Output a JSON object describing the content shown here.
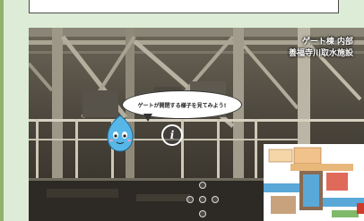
{
  "header": {
    "box_label": ""
  },
  "viewer": {
    "caption_line1": "ゲート棟 内部",
    "caption_line2": "善福寺川取水施設",
    "speech": "ゲートが開閉する様子を見てみよう!",
    "info_symbol": "i"
  },
  "colors": {
    "frame_green": "#8fb36b",
    "page_bg": "#ddecd6",
    "mascot_blue": "#57b7e8",
    "accent_red": "#d03a2c"
  },
  "icons": [
    "info-icon",
    "nav-up-icon",
    "nav-down-icon",
    "nav-left-icon",
    "nav-right-icon",
    "next-arrow-icon"
  ]
}
